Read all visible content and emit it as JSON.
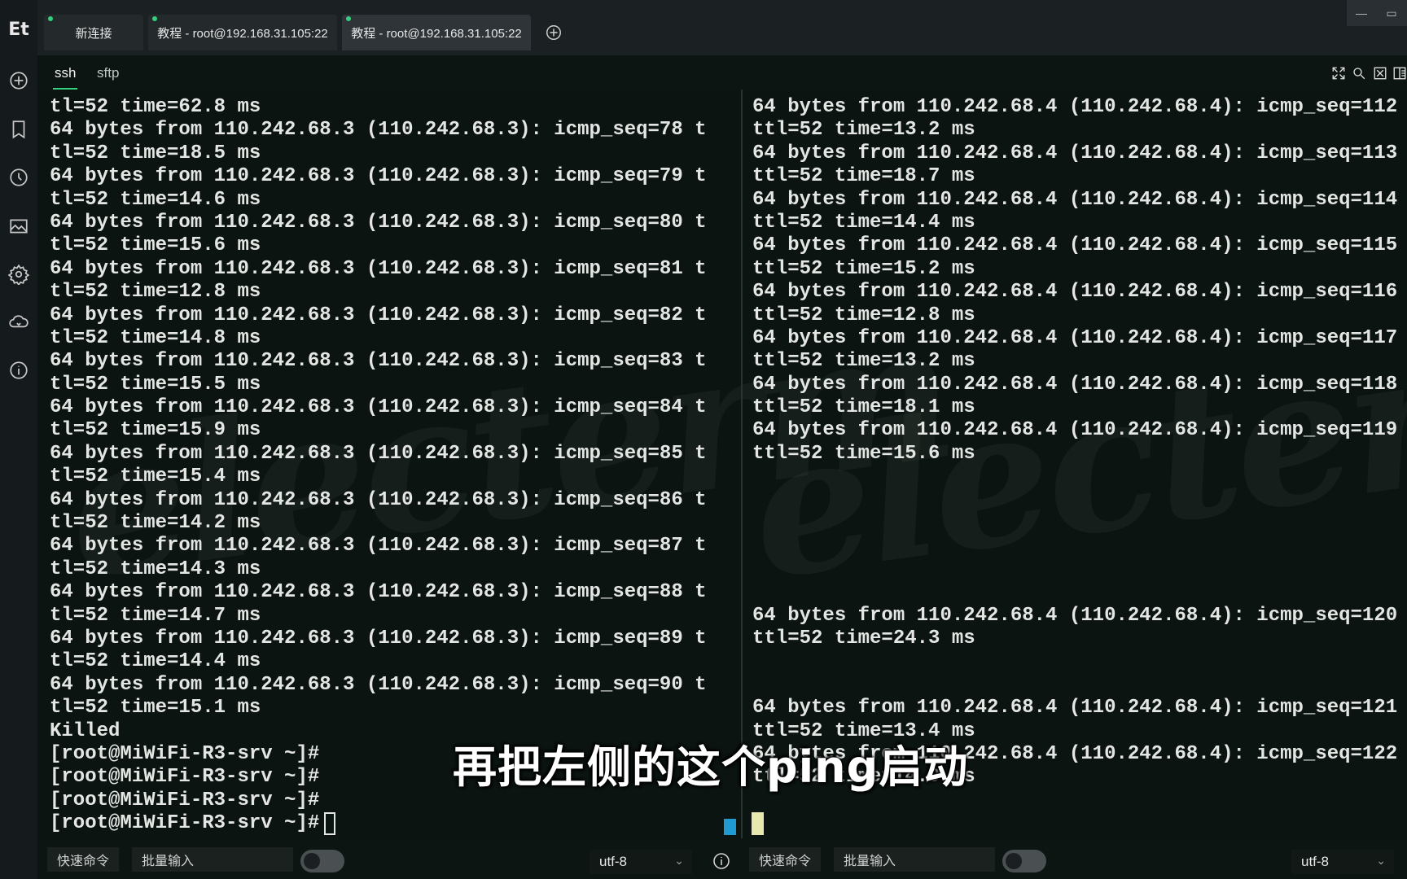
{
  "app": {
    "logo": "Et"
  },
  "tabs": [
    {
      "label": "新连接",
      "active": false
    },
    {
      "label": "教程 - root@192.168.31.105:22",
      "active": false
    },
    {
      "label": "教程 - root@192.168.31.105:22",
      "active": true
    }
  ],
  "subtabs": [
    {
      "label": "ssh",
      "active": true
    },
    {
      "label": "sftp",
      "active": false
    }
  ],
  "left_terminal": {
    "lines": [
      "tl=52 time=62.8 ms",
      "64 bytes from 110.242.68.3 (110.242.68.3): icmp_seq=78 t",
      "tl=52 time=18.5 ms",
      "64 bytes from 110.242.68.3 (110.242.68.3): icmp_seq=79 t",
      "tl=52 time=14.6 ms",
      "64 bytes from 110.242.68.3 (110.242.68.3): icmp_seq=80 t",
      "tl=52 time=15.6 ms",
      "64 bytes from 110.242.68.3 (110.242.68.3): icmp_seq=81 t",
      "tl=52 time=12.8 ms",
      "64 bytes from 110.242.68.3 (110.242.68.3): icmp_seq=82 t",
      "tl=52 time=14.8 ms",
      "64 bytes from 110.242.68.3 (110.242.68.3): icmp_seq=83 t",
      "tl=52 time=15.5 ms",
      "64 bytes from 110.242.68.3 (110.242.68.3): icmp_seq=84 t",
      "tl=52 time=15.9 ms",
      "64 bytes from 110.242.68.3 (110.242.68.3): icmp_seq=85 t",
      "tl=52 time=15.4 ms",
      "64 bytes from 110.242.68.3 (110.242.68.3): icmp_seq=86 t",
      "tl=52 time=14.2 ms",
      "64 bytes from 110.242.68.3 (110.242.68.3): icmp_seq=87 t",
      "tl=52 time=14.3 ms",
      "64 bytes from 110.242.68.3 (110.242.68.3): icmp_seq=88 t",
      "tl=52 time=14.7 ms",
      "64 bytes from 110.242.68.3 (110.242.68.3): icmp_seq=89 t",
      "tl=52 time=14.4 ms",
      "64 bytes from 110.242.68.3 (110.242.68.3): icmp_seq=90 t",
      "tl=52 time=15.1 ms",
      "Killed",
      "[root@MiWiFi-R3-srv ~]#",
      "[root@MiWiFi-R3-srv ~]#",
      "[root@MiWiFi-R3-srv ~]#",
      "[root@MiWiFi-R3-srv ~]#"
    ]
  },
  "right_terminal": {
    "lines": [
      "64 bytes from 110.242.68.4 (110.242.68.4): icmp_seq=112",
      "ttl=52 time=13.2 ms",
      "64 bytes from 110.242.68.4 (110.242.68.4): icmp_seq=113",
      "ttl=52 time=18.7 ms",
      "64 bytes from 110.242.68.4 (110.242.68.4): icmp_seq=114",
      "ttl=52 time=14.4 ms",
      "64 bytes from 110.242.68.4 (110.242.68.4): icmp_seq=115",
      "ttl=52 time=15.2 ms",
      "64 bytes from 110.242.68.4 (110.242.68.4): icmp_seq=116",
      "ttl=52 time=12.8 ms",
      "64 bytes from 110.242.68.4 (110.242.68.4): icmp_seq=117",
      "ttl=52 time=13.2 ms",
      "64 bytes from 110.242.68.4 (110.242.68.4): icmp_seq=118",
      "ttl=52 time=18.1 ms",
      "64 bytes from 110.242.68.4 (110.242.68.4): icmp_seq=119",
      "ttl=52 time=15.6 ms",
      "",
      "",
      "",
      "",
      "",
      "",
      "64 bytes from 110.242.68.4 (110.242.68.4): icmp_seq=120",
      "ttl=52 time=24.3 ms",
      "",
      "",
      "64 bytes from 110.242.68.4 (110.242.68.4): icmp_seq=121",
      "ttl=52 time=13.4 ms",
      "64 bytes from 110.242.68.4 (110.242.68.4): icmp_seq=122",
      "ttl=52 time=14.9 ms"
    ]
  },
  "bottom_left": {
    "quick_cmd": "快速命令",
    "batch_input": "批量输入",
    "encoding": "utf-8"
  },
  "bottom_right": {
    "quick_cmd": "快速命令",
    "batch_input": "批量输入",
    "encoding": "utf-8"
  },
  "subtitle": "再把左侧的这个ping启动",
  "watermark": "electerm",
  "colors": {
    "accent": "#35d07f",
    "background": "#0b1410",
    "text": "#e4e6e4"
  }
}
